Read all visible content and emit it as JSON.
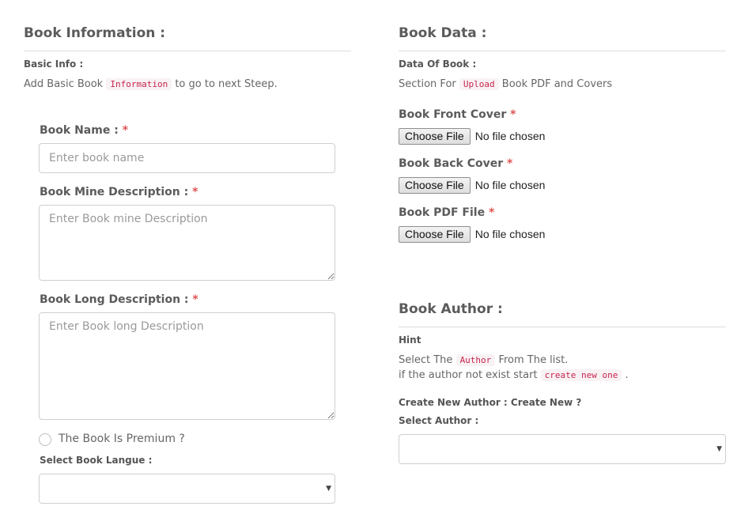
{
  "book_information": {
    "title": "Book Information :",
    "subheading": "Basic Info :",
    "desc_before": "Add Basic Book ",
    "desc_code": "Information",
    "desc_after": " to go to next Steep.",
    "book_name": {
      "label": "Book Name : ",
      "required": "*",
      "placeholder": "Enter book name",
      "value": ""
    },
    "mine_description": {
      "label": "Book Mine Description : ",
      "required": "*",
      "placeholder": "Enter Book mine Description",
      "value": ""
    },
    "long_description": {
      "label": "Book Long Description : ",
      "required": "*",
      "placeholder": "Enter Book long Description",
      "value": ""
    },
    "premium": {
      "label": "The Book Is Premium ?",
      "checked": false
    },
    "language": {
      "label": "Select Book Langue :",
      "value": ""
    }
  },
  "book_data": {
    "title": "Book Data :",
    "subheading": "Data Of Book :",
    "desc_before": "Section For ",
    "desc_code": "Upload",
    "desc_after": " Book PDF and Covers",
    "front_cover": {
      "label": "Book Front Cover ",
      "required": "*",
      "button": "Choose File",
      "status": "No file chosen"
    },
    "back_cover": {
      "label": "Book Back Cover ",
      "required": "*",
      "button": "Choose File",
      "status": "No file chosen"
    },
    "pdf_file": {
      "label": "Book PDF File ",
      "required": "*",
      "button": "Choose File",
      "status": "No file chosen"
    }
  },
  "book_author": {
    "title": "Book Author :",
    "hint_heading": "Hint",
    "hint_line1_before": "Select The ",
    "hint_line1_code": "Author",
    "hint_line1_after": " From The list.",
    "hint_line2_before": "if the author not exist start ",
    "hint_line2_code": "create new one",
    "hint_line2_after": " .",
    "create_new": "Create New Author : Create New ?",
    "select_label": "Select Author :",
    "select_value": ""
  },
  "icons": {
    "dropdown": "▼"
  }
}
